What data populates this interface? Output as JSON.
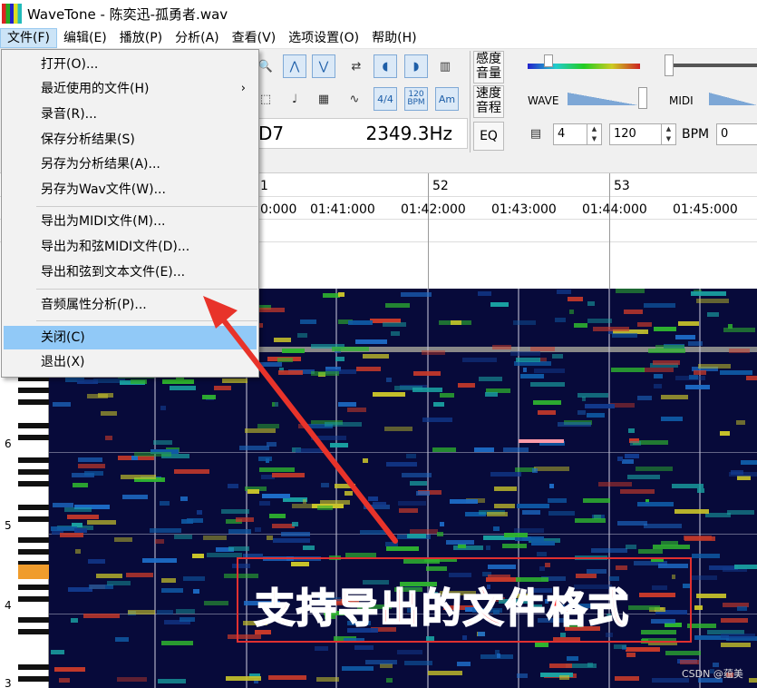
{
  "window": {
    "title": "WaveTone - 陈奕迅-孤勇者.wav"
  },
  "menu": [
    "文件(F)",
    "编辑(E)",
    "播放(P)",
    "分析(A)",
    "查看(V)",
    "选项设置(O)",
    "帮助(H)"
  ],
  "toolbar": {
    "btn_4_4": "4/4",
    "btn_bpm_top": "120",
    "btn_bpm_bottom": "BPM",
    "btn_am": "Am",
    "note_readout": "D7",
    "freq_readout": "2349.3Hz",
    "label_sens": "感度\n音量",
    "label_speed": "速度\n音程",
    "label_eq": "EQ",
    "label_wave": "WAVE",
    "label_midi": "MIDI",
    "beats_value": "4",
    "tempo_value": "120",
    "bpm_label": "BPM",
    "offset_value": "0"
  },
  "timeline": {
    "bars": [
      "1",
      "52",
      "53"
    ],
    "times": [
      "0:000",
      "01:41:000",
      "01:42:000",
      "01:43:000",
      "01:44:000",
      "01:45:000"
    ]
  },
  "piano": {
    "octave_labels": [
      "6",
      "5",
      "4",
      "3"
    ]
  },
  "file_menu": {
    "items": [
      {
        "label": "打开(O)...",
        "submenu": false
      },
      {
        "label": "最近使用的文件(H)",
        "submenu": true
      },
      {
        "label": "录音(R)...",
        "submenu": false
      },
      {
        "label": "保存分析结果(S)",
        "submenu": false
      },
      {
        "label": "另存为分析结果(A)...",
        "submenu": false
      },
      {
        "label": "另存为Wav文件(W)...",
        "submenu": false
      },
      {
        "label": "导出为MIDI文件(M)...",
        "submenu": false
      },
      {
        "label": "导出为和弦MIDI文件(D)...",
        "submenu": false
      },
      {
        "label": "导出和弦到文本文件(E)...",
        "submenu": false
      },
      {
        "label": "音频属性分析(P)...",
        "submenu": false
      },
      {
        "label": "关闭(C)",
        "submenu": false
      },
      {
        "label": "退出(X)",
        "submenu": false
      }
    ],
    "submenu_arrow": "›"
  },
  "annotation": {
    "caption": "支持导出的文件格式"
  },
  "watermark": "CSDN @蕴美",
  "colors": {
    "accent": "#e03030",
    "menu_highlight": "#91c9f7",
    "spectrogram_bg": "#070a3a"
  }
}
